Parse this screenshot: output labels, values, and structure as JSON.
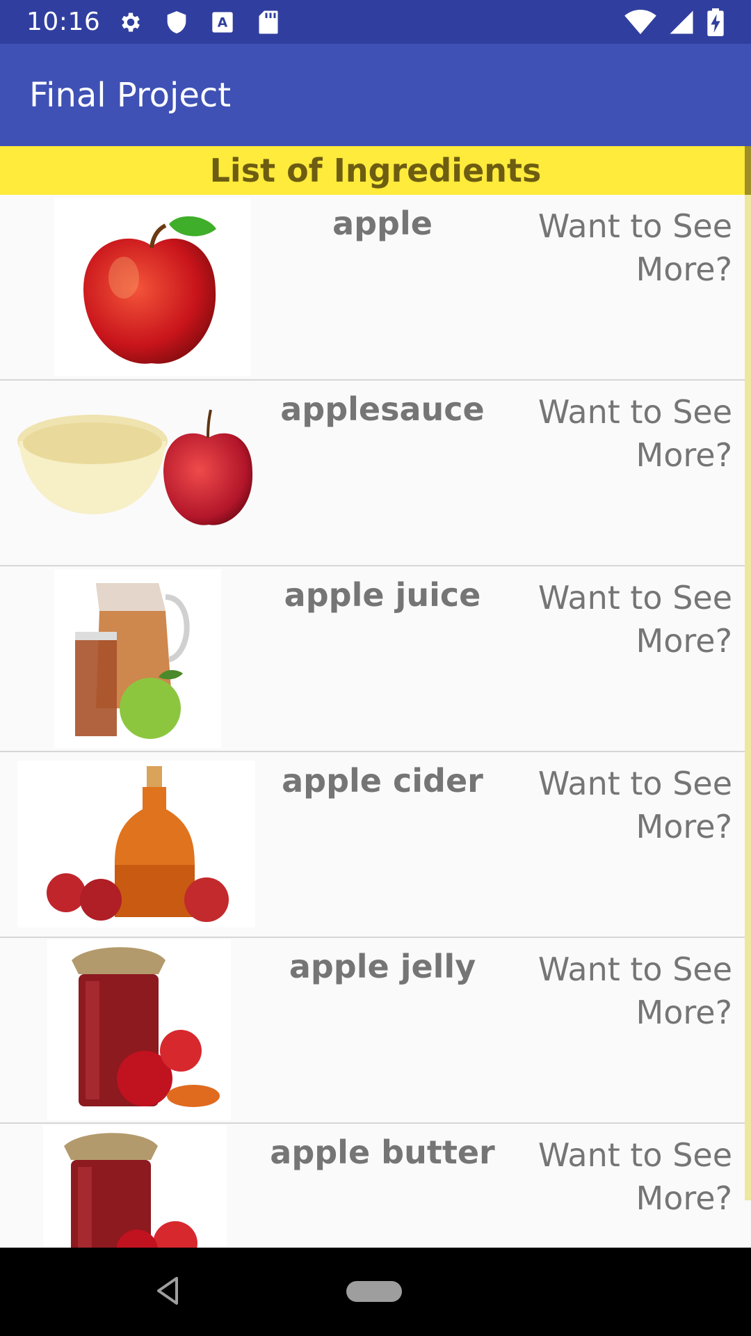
{
  "status_bar": {
    "time": "10:16",
    "icons_left": [
      "gear-icon",
      "shield-icon",
      "text-icon",
      "sd-card-icon"
    ],
    "icons_right": [
      "wifi-icon",
      "signal-icon",
      "battery-icon"
    ],
    "text_icon_label": "A"
  },
  "app_bar": {
    "title": "Final Project"
  },
  "list": {
    "header": "List of Ingredients",
    "items": [
      {
        "name": "apple",
        "action": "Want to See More?",
        "image": "apple-image"
      },
      {
        "name": "applesauce",
        "action": "Want to See More?",
        "image": "applesauce-image"
      },
      {
        "name": "apple juice",
        "action": "Want to See More?",
        "image": "apple-juice-image"
      },
      {
        "name": "apple cider",
        "action": "Want to See More?",
        "image": "apple-cider-image"
      },
      {
        "name": "apple jelly",
        "action": "Want to See More?",
        "image": "apple-jelly-image"
      },
      {
        "name": "apple butter",
        "action": "Want to See More?",
        "image": "apple-butter-image"
      }
    ]
  },
  "nav_bar": {
    "icons": [
      "back-icon",
      "home-icon"
    ]
  },
  "colors": {
    "status_bar": "#303f9f",
    "app_bar": "#3f51b5",
    "header_band": "#ffeb3b",
    "text_gray": "#757575"
  }
}
